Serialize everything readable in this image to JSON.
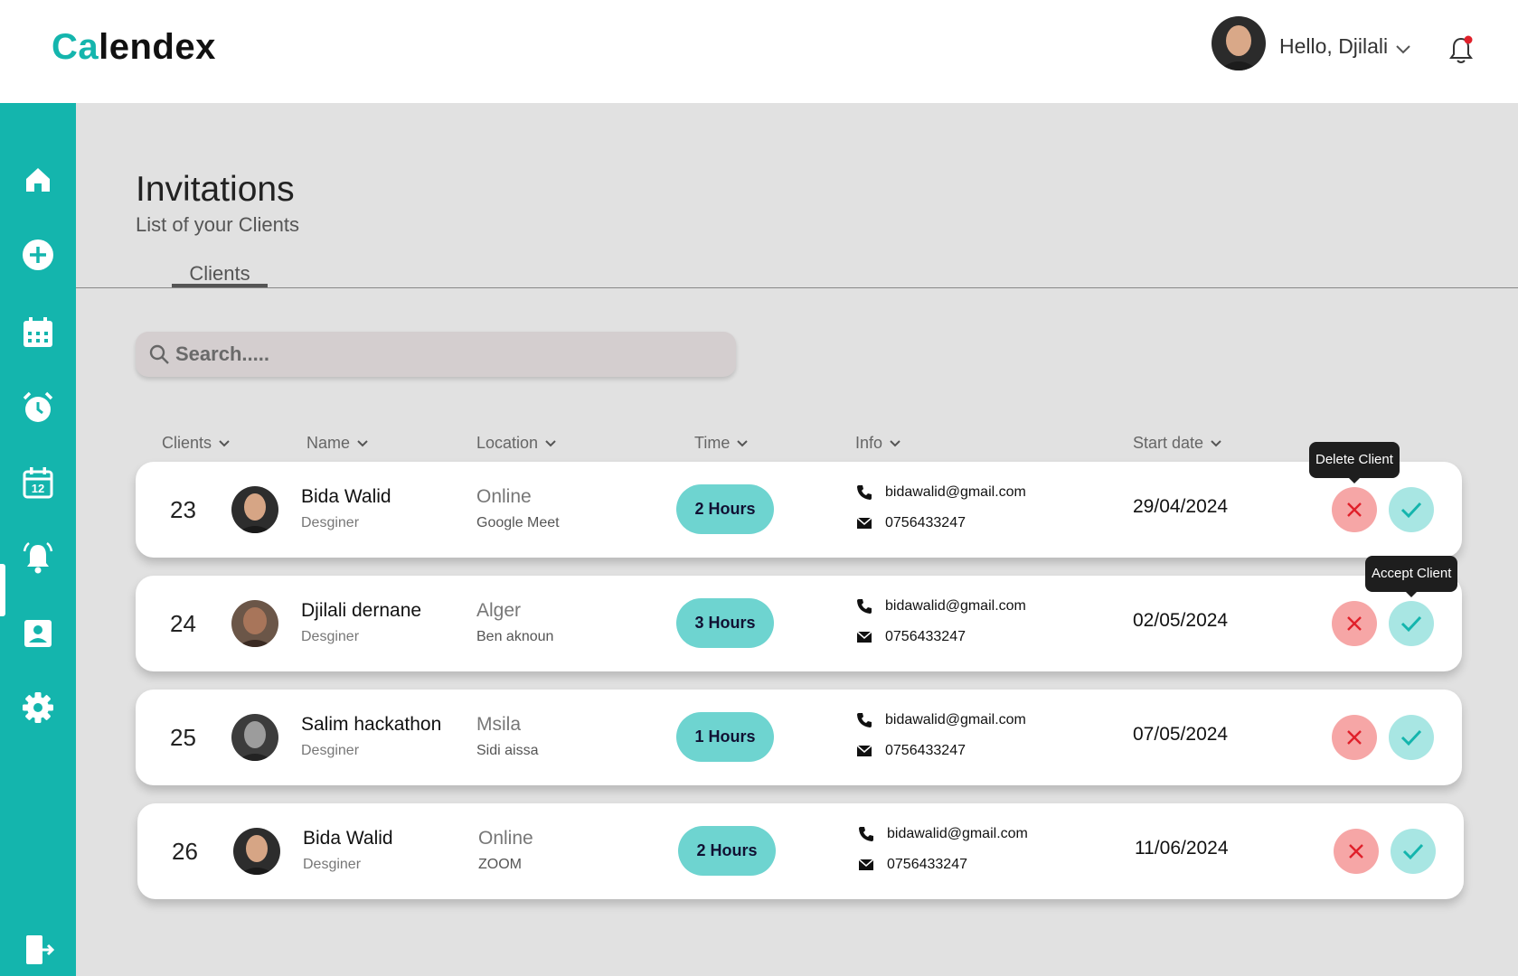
{
  "app": {
    "logo_accent": "Ca",
    "logo_rest": "lendex",
    "brand_color": "#14b5ad"
  },
  "header": {
    "greeting": "Hello, Djilali"
  },
  "page": {
    "title": "Invitations",
    "subtitle": "List of your Clients",
    "tab": "Clients"
  },
  "search": {
    "placeholder": "Search....."
  },
  "columns": [
    "Clients",
    "Name",
    "Location",
    "Time",
    "Info",
    "Start date"
  ],
  "tooltips": {
    "delete": "Delete Client",
    "accept": "Accept Client"
  },
  "rows": [
    {
      "id": "23",
      "name": "Bida Walid",
      "role": "Desginer",
      "location": "Online",
      "sub_location": "Google Meet",
      "time": "2 Hours",
      "email": "bidawalid@gmail.com",
      "phone": "0756433247",
      "start_date": "29/04/2024"
    },
    {
      "id": "24",
      "name": "Djilali dernane",
      "role": "Desginer",
      "location": "Alger",
      "sub_location": "Ben aknoun",
      "time": "3 Hours",
      "email": "bidawalid@gmail.com",
      "phone": "0756433247",
      "start_date": "02/05/2024"
    },
    {
      "id": "25",
      "name": "Salim hackathon",
      "role": "Desginer",
      "location": "Msila",
      "sub_location": "Sidi aissa",
      "time": "1 Hours",
      "email": "bidawalid@gmail.com",
      "phone": "0756433247",
      "start_date": "07/05/2024"
    },
    {
      "id": "26",
      "name": "Bida Walid",
      "role": "Desginer",
      "location": "Online",
      "sub_location": "ZOOM",
      "time": "2 Hours",
      "email": "bidawalid@gmail.com",
      "phone": "0756433247",
      "start_date": "11/06/2024"
    }
  ]
}
